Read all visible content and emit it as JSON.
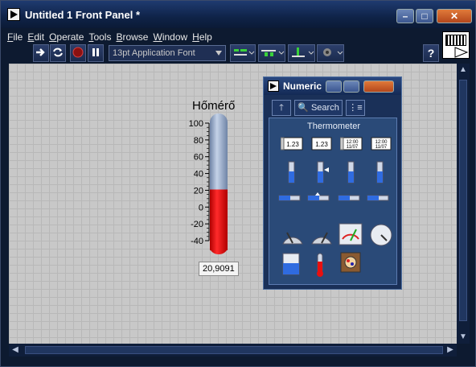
{
  "window": {
    "title": "Untitled 1 Front Panel *"
  },
  "menu": [
    "File",
    "Edit",
    "Operate",
    "Tools",
    "Browse",
    "Window",
    "Help"
  ],
  "toolbar": {
    "font": "13pt Application Font",
    "help": "?"
  },
  "thermometer": {
    "label": "Hőmérő",
    "scale": [
      "100",
      "80",
      "60",
      "40",
      "20",
      "0",
      "-20",
      "-40"
    ],
    "value": 20.9091,
    "min": -40,
    "max": 100,
    "readout": "20,9091",
    "fill_color": "#e81010",
    "tube_color": "#9ab0d0"
  },
  "palette": {
    "title": "Numeric",
    "search": "Search",
    "category": "Thermometer",
    "items": [
      {
        "name": "numeric-control-icon",
        "text": "1.23"
      },
      {
        "name": "numeric-indicator-icon",
        "text": "1.23"
      },
      {
        "name": "timestamp-control-icon",
        "text": "12:00 11/07"
      },
      {
        "name": "timestamp-indicator-icon",
        "text": "12:00 11/07"
      },
      {
        "name": "vertical-fill-slide-icon",
        "text": ""
      },
      {
        "name": "vertical-pointer-slide-icon",
        "text": ""
      },
      {
        "name": "vertical-progress-bar-icon",
        "text": ""
      },
      {
        "name": "vertical-graduated-bar-icon",
        "text": ""
      },
      {
        "name": "horizontal-fill-slide-icon",
        "text": ""
      },
      {
        "name": "horizontal-pointer-slide-icon",
        "text": ""
      },
      {
        "name": "horizontal-progress-bar-icon",
        "text": ""
      },
      {
        "name": "horizontal-graduated-bar-icon",
        "text": ""
      },
      {
        "name": "knob-icon",
        "text": ""
      },
      {
        "name": "dial-icon",
        "text": ""
      },
      {
        "name": "meter-icon",
        "text": ""
      },
      {
        "name": "gauge-icon",
        "text": ""
      },
      {
        "name": "tank-icon",
        "text": ""
      },
      {
        "name": "thermometer-icon",
        "text": ""
      },
      {
        "name": "framed-color-box-icon",
        "text": ""
      }
    ]
  }
}
